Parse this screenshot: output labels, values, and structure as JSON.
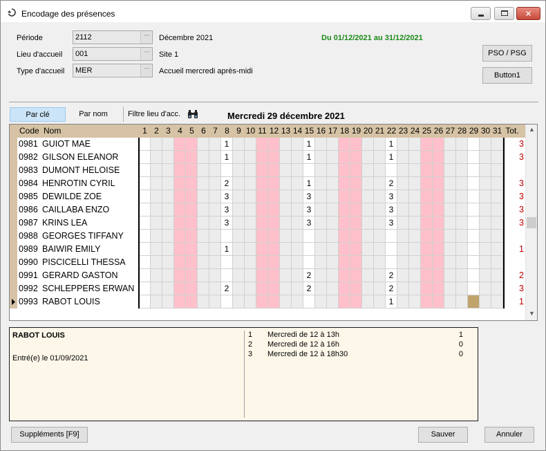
{
  "window": {
    "title": "Encodage des présences"
  },
  "form": {
    "periode": {
      "label": "Période",
      "value": "2112",
      "desc": "Décembre 2021"
    },
    "lieu": {
      "label": "Lieu d'accueil",
      "value": "001",
      "desc": "Site 1"
    },
    "type": {
      "label": "Type d'accueil",
      "value": "MER",
      "desc": "Accueil mercredi après-midi"
    },
    "range": "Du 01/12/2021 au 31/12/2021",
    "ellipsis": "···"
  },
  "buttons": {
    "pso": "PSO / PSG",
    "button1": "Button1",
    "supplements": "Suppléments   [F9]",
    "sauver": "Sauver",
    "annuler": "Annuler"
  },
  "tabs": {
    "par_cle": "Par clé",
    "par_nom": "Par nom",
    "filtre": "Filtre lieu d'acc."
  },
  "day_title": "Mercredi 29 décembre 2021",
  "grid": {
    "col_code": "Code",
    "col_nom": "Nom",
    "col_tot": "Tot.",
    "days": [
      1,
      2,
      3,
      4,
      5,
      6,
      7,
      8,
      9,
      10,
      11,
      12,
      13,
      14,
      15,
      16,
      17,
      18,
      19,
      20,
      21,
      22,
      23,
      24,
      25,
      26,
      27,
      28,
      29,
      30,
      31
    ],
    "weekend_days": [
      4,
      5,
      11,
      12,
      18,
      19,
      25,
      26
    ],
    "white_days": [
      1,
      8,
      15,
      22,
      29
    ],
    "current_day": 29,
    "rows": [
      {
        "code": "0981",
        "name": "GUIOT MAE",
        "marks": {
          "8": "1",
          "15": "1",
          "22": "1"
        },
        "tot": "3"
      },
      {
        "code": "0982",
        "name": "GILSON ELEANOR",
        "marks": {
          "8": "1",
          "15": "1",
          "22": "1"
        },
        "tot": "3"
      },
      {
        "code": "0983",
        "name": "DUMONT HELOISE",
        "marks": {},
        "tot": ""
      },
      {
        "code": "0984",
        "name": "HENROTIN CYRIL",
        "marks": {
          "8": "2",
          "15": "1",
          "22": "2"
        },
        "tot": "3"
      },
      {
        "code": "0985",
        "name": "DEWILDE ZOE",
        "marks": {
          "8": "3",
          "15": "3",
          "22": "3"
        },
        "tot": "3"
      },
      {
        "code": "0986",
        "name": "CAILLABA ENZO",
        "marks": {
          "8": "3",
          "15": "3",
          "22": "3"
        },
        "tot": "3"
      },
      {
        "code": "0987",
        "name": "KRINS LEA",
        "marks": {
          "8": "3",
          "15": "3",
          "22": "3"
        },
        "tot": "3"
      },
      {
        "code": "0988",
        "name": "GEORGES TIFFANY",
        "marks": {},
        "tot": ""
      },
      {
        "code": "0989",
        "name": "BAIWIR EMILY",
        "marks": {
          "8": "1"
        },
        "tot": "1"
      },
      {
        "code": "0990",
        "name": "PISCICELLI THESSA",
        "marks": {},
        "tot": ""
      },
      {
        "code": "0991",
        "name": "GERARD GASTON",
        "marks": {
          "15": "2",
          "22": "2"
        },
        "tot": "2"
      },
      {
        "code": "0992",
        "name": "SCHLEPPERS ERWAN",
        "marks": {
          "8": "2",
          "15": "2",
          "22": "2"
        },
        "tot": "3"
      },
      {
        "code": "0993",
        "name": "RABOT LOUIS",
        "marks": {
          "22": "1"
        },
        "tot": "1",
        "selected": true
      }
    ]
  },
  "detail": {
    "name": "RABOT LOUIS",
    "entry": "Entré(e) le 01/09/2021",
    "options": [
      {
        "num": "1",
        "label": "Mercredi de 12 à 13h",
        "count": "1"
      },
      {
        "num": "2",
        "label": "Mercredi de 12 à 16h",
        "count": "0"
      },
      {
        "num": "3",
        "label": "Mercredi de 12 à 18h30",
        "count": "0"
      }
    ]
  },
  "colors": {
    "weekend": "#ffc0cb",
    "normal": "#ececec",
    "white": "#ffffff",
    "current": "#c0a46b",
    "header": "#d6c3a5",
    "total": "#c00000",
    "range": "#1b8a17"
  }
}
